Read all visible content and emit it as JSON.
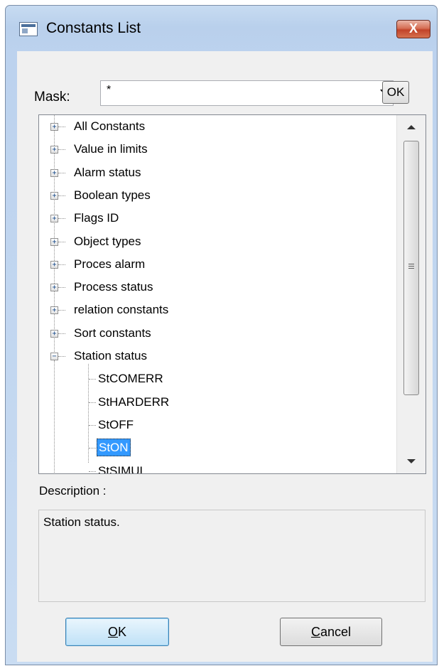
{
  "window": {
    "title": "Constants List",
    "close_glyph": "X",
    "icon": "window-app-icon"
  },
  "mask": {
    "label": "Mask:",
    "value": "*",
    "ok_label": "OK"
  },
  "tree": {
    "items": [
      {
        "label": "All Constants",
        "expanded": false
      },
      {
        "label": "Value in limits",
        "expanded": false
      },
      {
        "label": "Alarm status",
        "expanded": false
      },
      {
        "label": "Boolean types",
        "expanded": false
      },
      {
        "label": "Flags ID",
        "expanded": false
      },
      {
        "label": "Object types",
        "expanded": false
      },
      {
        "label": "Proces alarm",
        "expanded": false
      },
      {
        "label": "Process status",
        "expanded": false
      },
      {
        "label": "relation constants",
        "expanded": false
      },
      {
        "label": "Sort constants",
        "expanded": false
      },
      {
        "label": "Station status",
        "expanded": true
      }
    ],
    "children": [
      {
        "label": "StCOMERR",
        "selected": false
      },
      {
        "label": "StHARDERR",
        "selected": false
      },
      {
        "label": "StOFF",
        "selected": false
      },
      {
        "label": "StON",
        "selected": true
      },
      {
        "label": "StSIMUL",
        "selected": false
      }
    ],
    "collapsed_glyph": "+",
    "expanded_glyph": "−"
  },
  "description": {
    "label": "Description :",
    "text": "Station status."
  },
  "buttons": {
    "ok_first": "O",
    "ok_rest": "K",
    "cancel_first": "C",
    "cancel_rest": "ancel"
  },
  "colors": {
    "selection": "#3399ff",
    "title_bar": "#bcd2ee",
    "close_button": "#c1432a"
  }
}
